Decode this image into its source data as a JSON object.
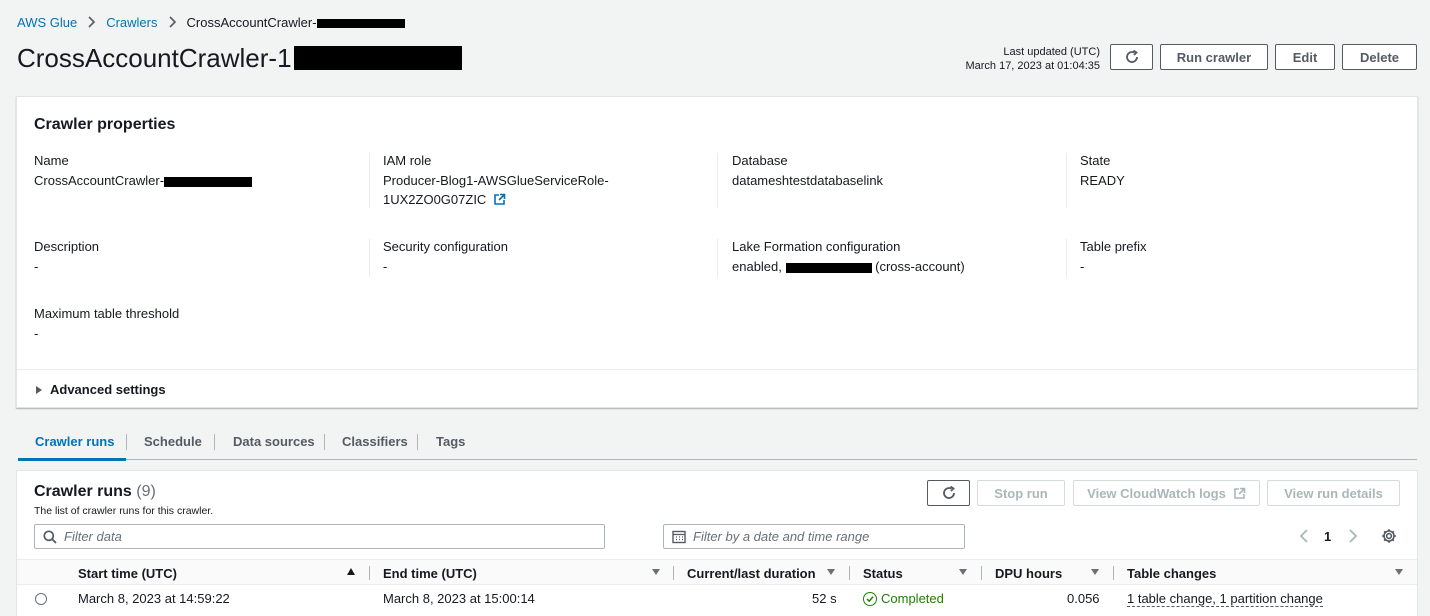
{
  "breadcrumb": {
    "items": [
      "AWS Glue",
      "Crawlers",
      "CrossAccountCrawler-"
    ]
  },
  "page": {
    "title": "CrossAccountCrawler-1"
  },
  "header": {
    "last_updated_label": "Last updated (UTC)",
    "last_updated_value": "March 17, 2023 at 01:04:35",
    "run_crawler": "Run crawler",
    "edit": "Edit",
    "delete": "Delete"
  },
  "properties": {
    "title": "Crawler properties",
    "name_label": "Name",
    "name_value": "CrossAccountCrawler-",
    "iam_role_label": "IAM role",
    "iam_role_line1": "Producer-Blog1-AWSGlueServiceRole-",
    "iam_role_line2": "1UX2ZO0G07ZIC",
    "database_label": "Database",
    "database_value": "datameshtestdatabaselink",
    "state_label": "State",
    "state_value": "READY",
    "description_label": "Description",
    "description_value": "-",
    "security_label": "Security configuration",
    "security_value": "-",
    "lakeformation_label": "Lake Formation configuration",
    "lakeformation_prefix": "enabled,",
    "lakeformation_suffix": "(cross-account)",
    "table_prefix_label": "Table prefix",
    "table_prefix_value": "-",
    "max_threshold_label": "Maximum table threshold",
    "max_threshold_value": "-",
    "advanced_settings": "Advanced settings"
  },
  "tabs": [
    "Crawler runs",
    "Schedule",
    "Data sources",
    "Classifiers",
    "Tags"
  ],
  "runs": {
    "title": "Crawler runs",
    "count": "(9)",
    "description": "The list of crawler runs for this crawler.",
    "stop_run": "Stop run",
    "view_cloudwatch": "View CloudWatch logs",
    "view_details": "View run details",
    "filter_placeholder": "Filter data",
    "date_filter_placeholder": "Filter by a date and time range",
    "page_number": "1",
    "columns": [
      "Start time (UTC)",
      "End time (UTC)",
      "Current/last duration",
      "Status",
      "DPU hours",
      "Table changes"
    ],
    "rows": [
      {
        "start": "March 8, 2023 at 14:59:22",
        "end": "March 8, 2023 at 15:00:14",
        "duration": "52 s",
        "status": "Completed",
        "dpu": "0.056",
        "changes": "1 table change, 1 partition change"
      }
    ]
  },
  "colors": {
    "link": "#0073bb",
    "success": "#1d8102",
    "redaction": "#000000"
  }
}
